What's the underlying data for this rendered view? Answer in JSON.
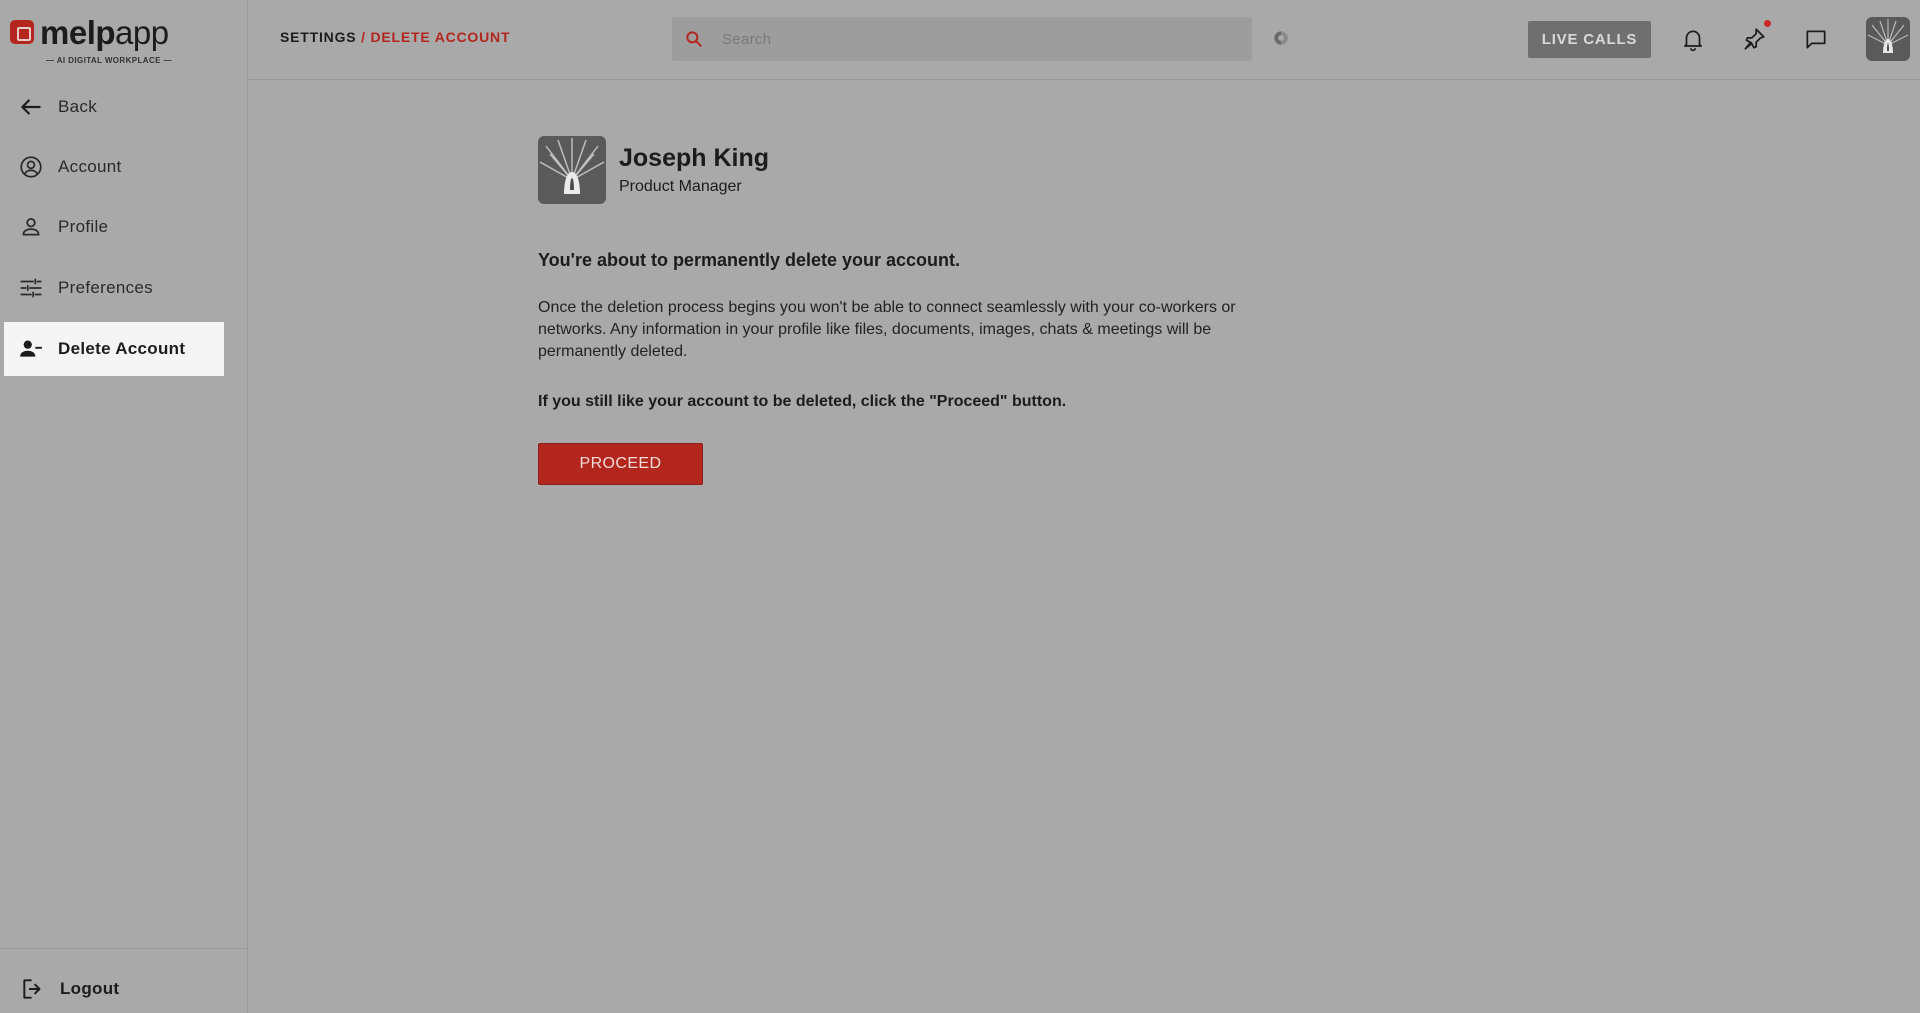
{
  "brand": {
    "name_bold": "melp",
    "name_light": "app",
    "tagline": "— AI DIGITAL WORKPLACE —",
    "accent": "#b3261e"
  },
  "sidebar": {
    "items": [
      {
        "label": "Back",
        "icon": "arrow-left-icon"
      },
      {
        "label": "Account",
        "icon": "account-circle-icon"
      },
      {
        "label": "Profile",
        "icon": "person-icon"
      },
      {
        "label": "Preferences",
        "icon": "sliders-icon"
      },
      {
        "label": "Delete Account",
        "icon": "person-remove-icon",
        "active": true
      }
    ],
    "logout": {
      "label": "Logout",
      "icon": "logout-icon"
    }
  },
  "header": {
    "breadcrumb_root": "SETTINGS",
    "breadcrumb_sep": " / ",
    "breadcrumb_current": "DELETE ACCOUNT",
    "search_placeholder": "Search",
    "live_calls": "LIVE CALLS"
  },
  "profile": {
    "name": "Joseph King",
    "role": "Product Manager"
  },
  "content": {
    "heading": "You're about to permanently delete your account.",
    "body": "Once the deletion process begins you won't be able to connect seamlessly with your co-workers or networks. Any information in your profile like files, documents, images, chats & meetings will be permanently deleted.",
    "instruction_pre": "If you still like your account to be deleted, click the ",
    "instruction_bold": "\"Proceed\"",
    "instruction_post": " button.",
    "proceed_label": "PROCEED"
  }
}
